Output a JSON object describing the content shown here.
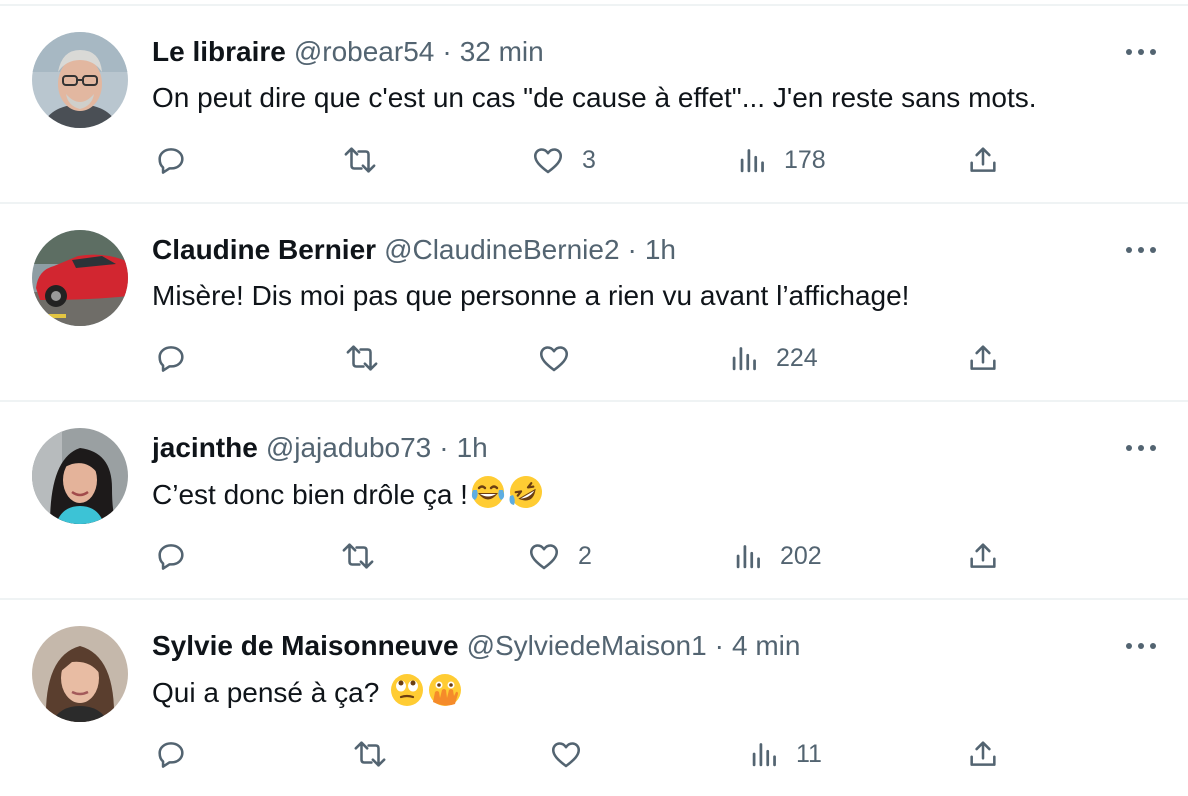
{
  "tweets": [
    {
      "name": "Le libraire",
      "handle": "@robear54",
      "separator": "·",
      "time": "32 min",
      "text": "On peut dire que c'est un cas \"de cause à effet\"... J'en reste sans mots.",
      "emojis": [],
      "likes": "3",
      "views": "178",
      "avatar": "older-man-glasses"
    },
    {
      "name": "Claudine Bernier",
      "handle": "@ClaudineBernie2",
      "separator": "·",
      "time": "1h",
      "text": "Misère! Dis moi pas que personne a rien vu avant l’affichage!",
      "emojis": [],
      "likes": "",
      "views": "224",
      "avatar": "red-car"
    },
    {
      "name": "jacinthe",
      "handle": "@jajadubo73",
      "separator": "·",
      "time": "1h",
      "text": "C’est donc bien drôle ça !",
      "emojis": [
        "face-with-tears-of-joy",
        "rolling-on-the-floor-laughing"
      ],
      "likes": "2",
      "views": "202",
      "avatar": "woman-dark-hair"
    },
    {
      "name": "Sylvie de Maisonneuve",
      "handle": "@SylviedeMaison1",
      "separator": "·",
      "time": "4 min",
      "text": "Qui a pensé à ça?",
      "emojis": [
        "face-with-rolling-eyes",
        "face-with-open-eyes-and-hand-over-mouth"
      ],
      "likes": "",
      "views": "11",
      "avatar": "woman-brown-hair"
    }
  ],
  "icons": {
    "reply": "reply-icon",
    "retweet": "retweet-icon",
    "like": "heart-icon",
    "views": "views-icon",
    "share": "share-icon",
    "more": "more-icon"
  },
  "colors": {
    "text": "#0f1419",
    "secondary": "#536471",
    "divider": "#eff3f4"
  }
}
